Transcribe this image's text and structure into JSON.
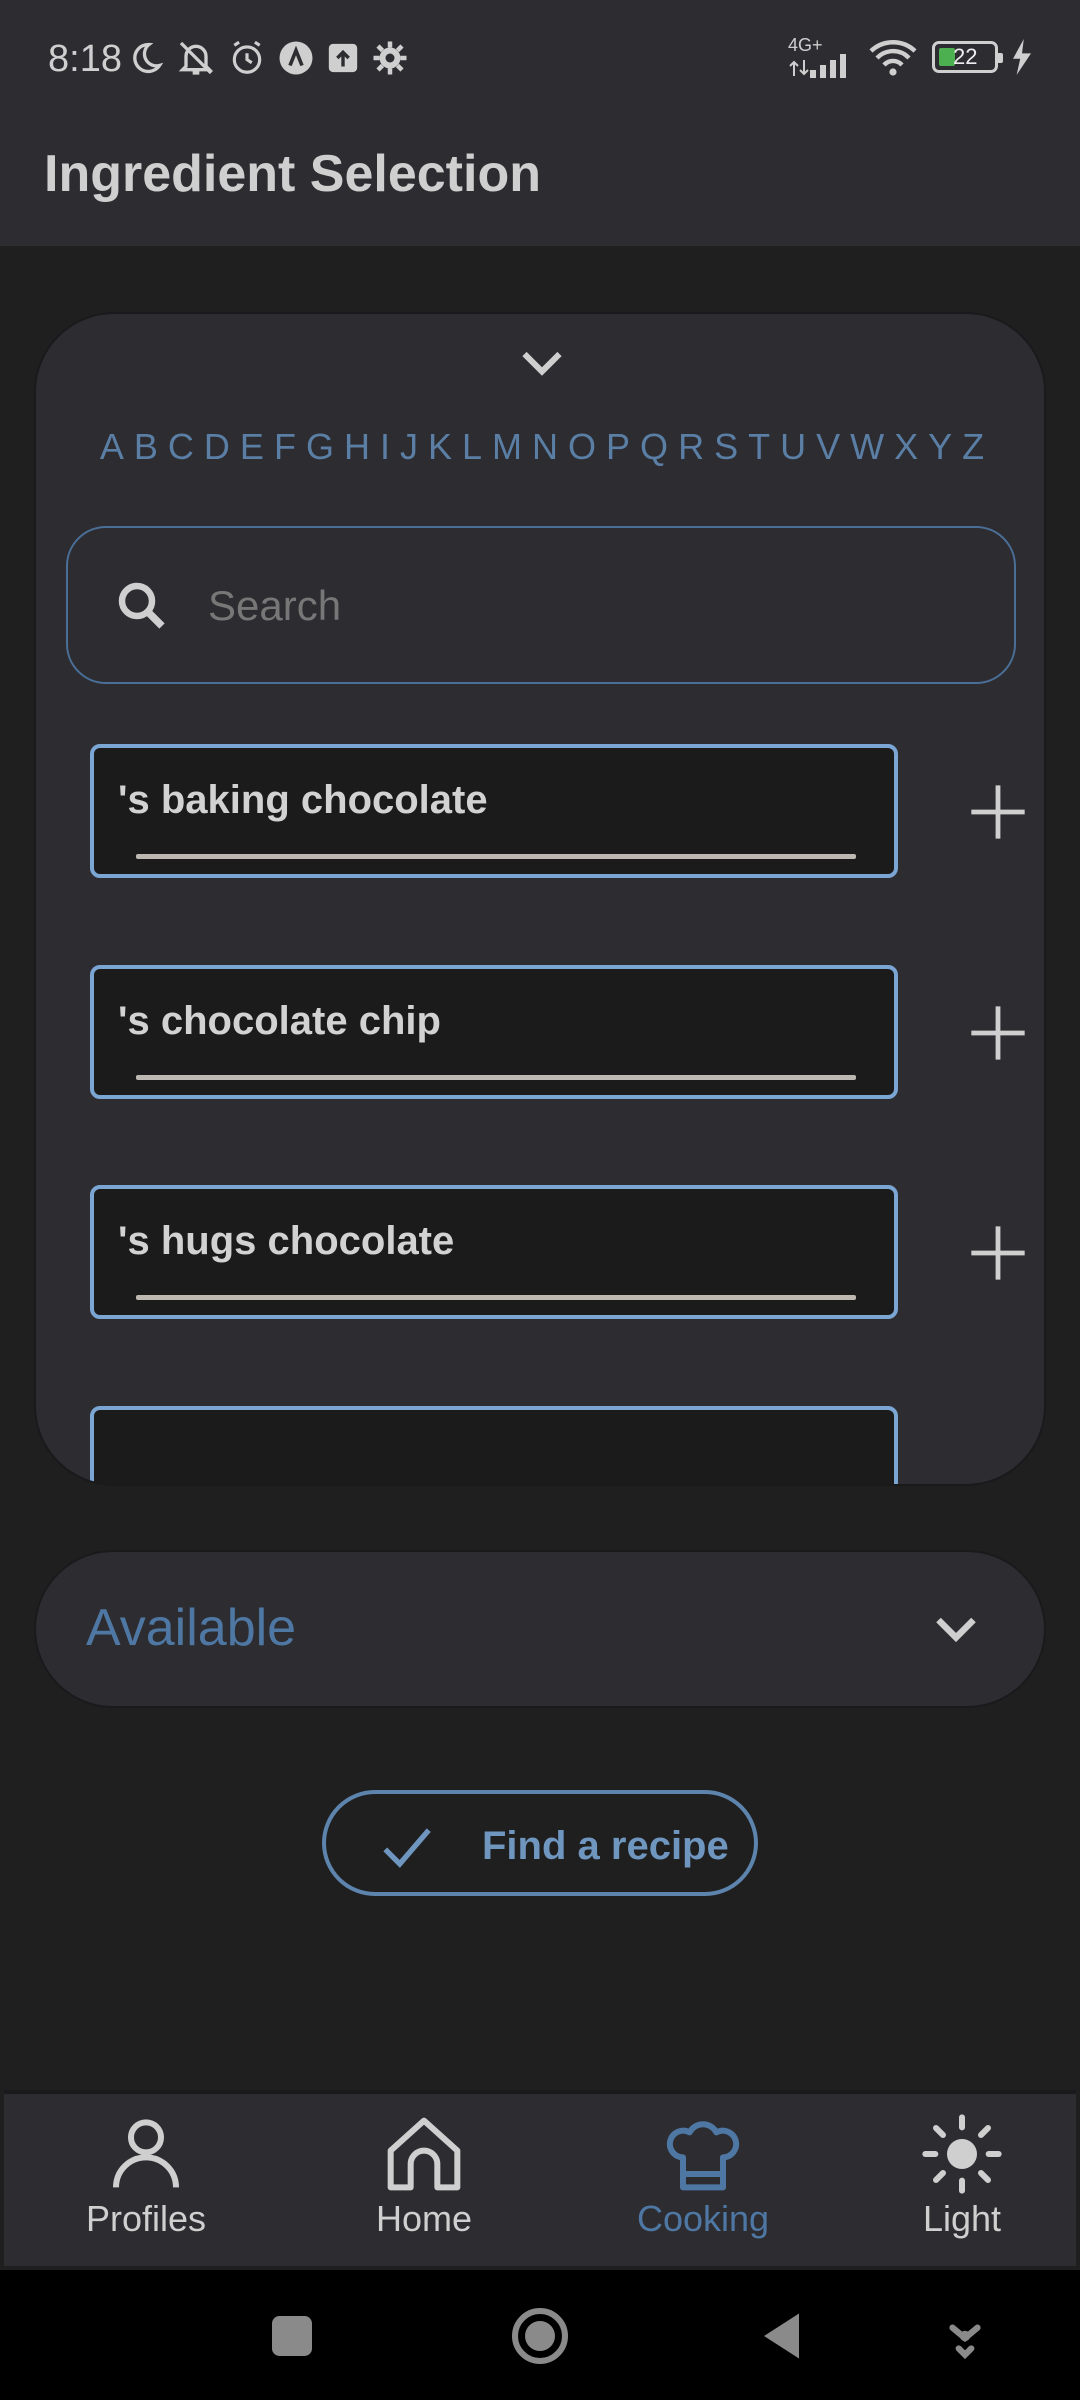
{
  "status_bar": {
    "time": "8:18",
    "network": "4G+",
    "battery": "22"
  },
  "app_bar": {
    "title": "Ingredient Selection"
  },
  "alphabet": [
    "A",
    "B",
    "C",
    "D",
    "E",
    "F",
    "G",
    "H",
    "I",
    "J",
    "K",
    "L",
    "M",
    "N",
    "O",
    "P",
    "Q",
    "R",
    "S",
    "T",
    "U",
    "V",
    "W",
    "X",
    "Y",
    "Z"
  ],
  "search": {
    "placeholder": "Search",
    "value": ""
  },
  "ingredients": [
    {
      "label": "'s baking chocolate"
    },
    {
      "label": "'s chocolate chip"
    },
    {
      "label": "'s hugs chocolate"
    }
  ],
  "available": {
    "label": "Available"
  },
  "find_recipe": {
    "label": "Find a recipe"
  },
  "bottom_nav": {
    "items": [
      {
        "label": "Profiles",
        "icon": "person-icon"
      },
      {
        "label": "Home",
        "icon": "home-icon"
      },
      {
        "label": "Cooking",
        "icon": "chef-hat-icon",
        "active": true
      },
      {
        "label": "Light",
        "icon": "sun-icon"
      }
    ]
  },
  "colors": {
    "accent": "#4e78a3",
    "chip_border": "#7ba5d3",
    "surface": "#2d2c31",
    "background": "#1f1f20"
  }
}
